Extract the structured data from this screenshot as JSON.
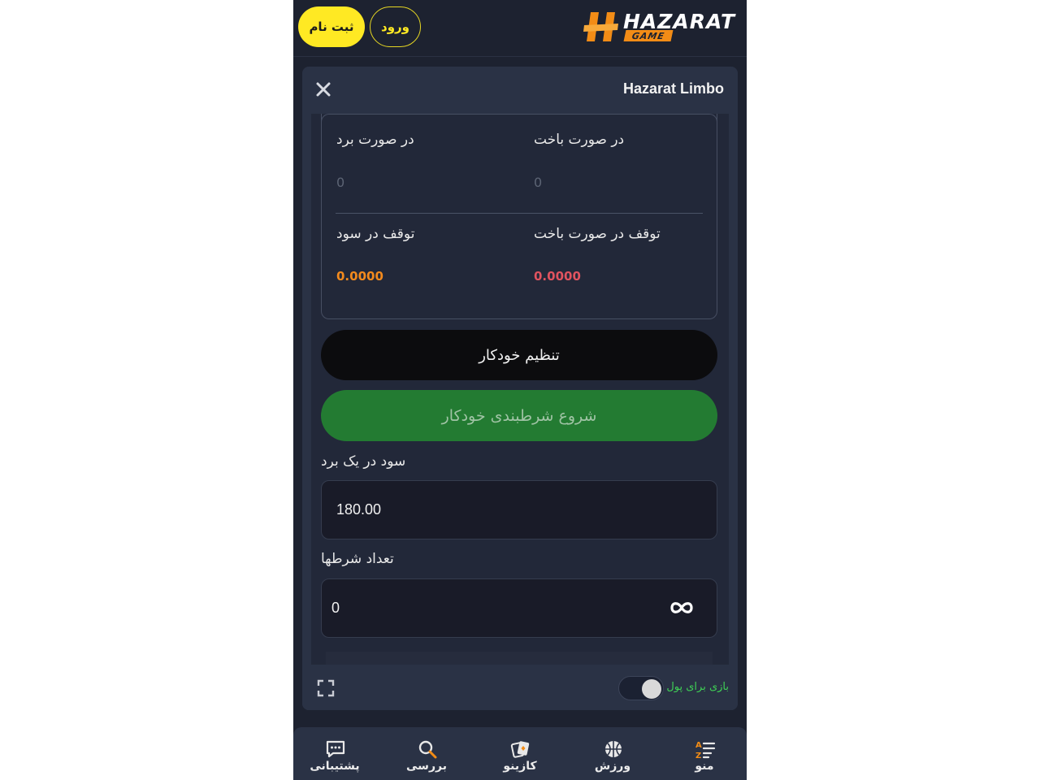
{
  "header": {
    "signup_label": "ثبت نام",
    "login_label": "ورود",
    "logo_text": "HAZARAT",
    "logo_sub": "GAME"
  },
  "game": {
    "title": "Hazarat Limbo",
    "on_win_label": "در صورت برد",
    "on_win_value": "0",
    "on_loss_label": "در صورت باخت",
    "on_loss_value": "0",
    "stop_on_profit_label": "توقف در سود",
    "stop_on_profit_value": "0.0000",
    "stop_on_loss_label": "توقف در صورت باخت",
    "stop_on_loss_value": "0.0000",
    "auto_settings_label": "تنظیم خودکار",
    "start_auto_label": "شروع شرطبندی خودکار",
    "profit_on_win_label": "سود در یک برد",
    "profit_on_win_value": "180.00",
    "bet_count_label": "تعداد شرطها",
    "bet_count_value": "0",
    "real_money_label": "بازی برای پول",
    "real_money_enabled": false
  },
  "nav": {
    "support": "پشتیبانی",
    "search": "بررسی",
    "casino": "کازینو",
    "sport": "ورزش",
    "menu": "منو"
  },
  "colors": {
    "accent_yellow": "#ffe923",
    "brand_orange": "#f28c16",
    "green_button": "#237b32",
    "profit_orange": "#f38a1d",
    "loss_red": "#e0535f",
    "toggle_label_green": "#3fcf55"
  }
}
